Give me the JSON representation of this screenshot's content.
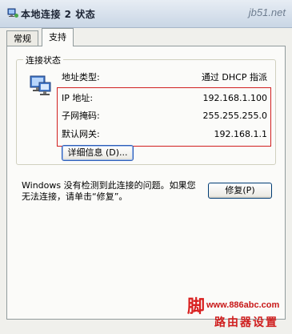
{
  "window": {
    "title": "本地连接 2 状态",
    "watermark": "jb51.net"
  },
  "tabs": [
    {
      "label": "常规",
      "active": false
    },
    {
      "label": "支持",
      "active": true
    }
  ],
  "connection_status": {
    "legend": "连接状态",
    "rows": [
      {
        "label": "地址类型:",
        "value": "通过 DHCP 指派"
      },
      {
        "label": "IP 地址:",
        "value": "192.168.1.100"
      },
      {
        "label": "子网掩码:",
        "value": "255.255.255.0"
      },
      {
        "label": "默认网关:",
        "value": "192.168.1.1"
      }
    ],
    "details_button": "详细信息 (D)..."
  },
  "repair": {
    "message": "Windows 没有检测到此连接的问题。如果您无法连接，请单击“修复”。",
    "button": "修复(P)"
  },
  "site_watermark": {
    "brand": "脚",
    "url": "www.886abc.com",
    "caption": "路由器设置"
  },
  "colors": {
    "highlight_border": "#d12020",
    "panel_background": "#fbfbf9"
  }
}
